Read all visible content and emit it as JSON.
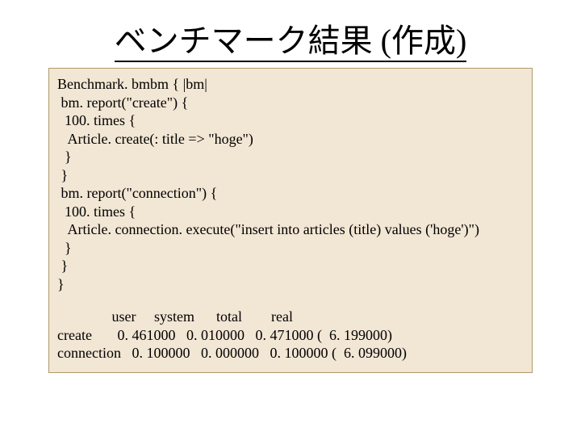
{
  "title": "ベンチマーク結果 (作成)",
  "code": {
    "l1": "Benchmark. bmbm { |bm|",
    "l2": " bm. report(\"create\") {",
    "l3": "  100. times {",
    "l4": "   Article. create(: title => \"hoge\")",
    "l5": "  }",
    "l6": " }",
    "l7": " bm. report(\"connection\") {",
    "l8": "  100. times {",
    "l9": "   Article. connection. execute(\"insert into articles (title) values ('hoge')\")",
    "l10": "  }",
    "l11": " }",
    "l12": "}"
  },
  "results": {
    "header": "               user     system      total        real",
    "row1": "create       0. 461000   0. 010000   0. 471000 (  6. 199000)",
    "row2": "connection   0. 100000   0. 000000   0. 100000 (  6. 099000)"
  }
}
